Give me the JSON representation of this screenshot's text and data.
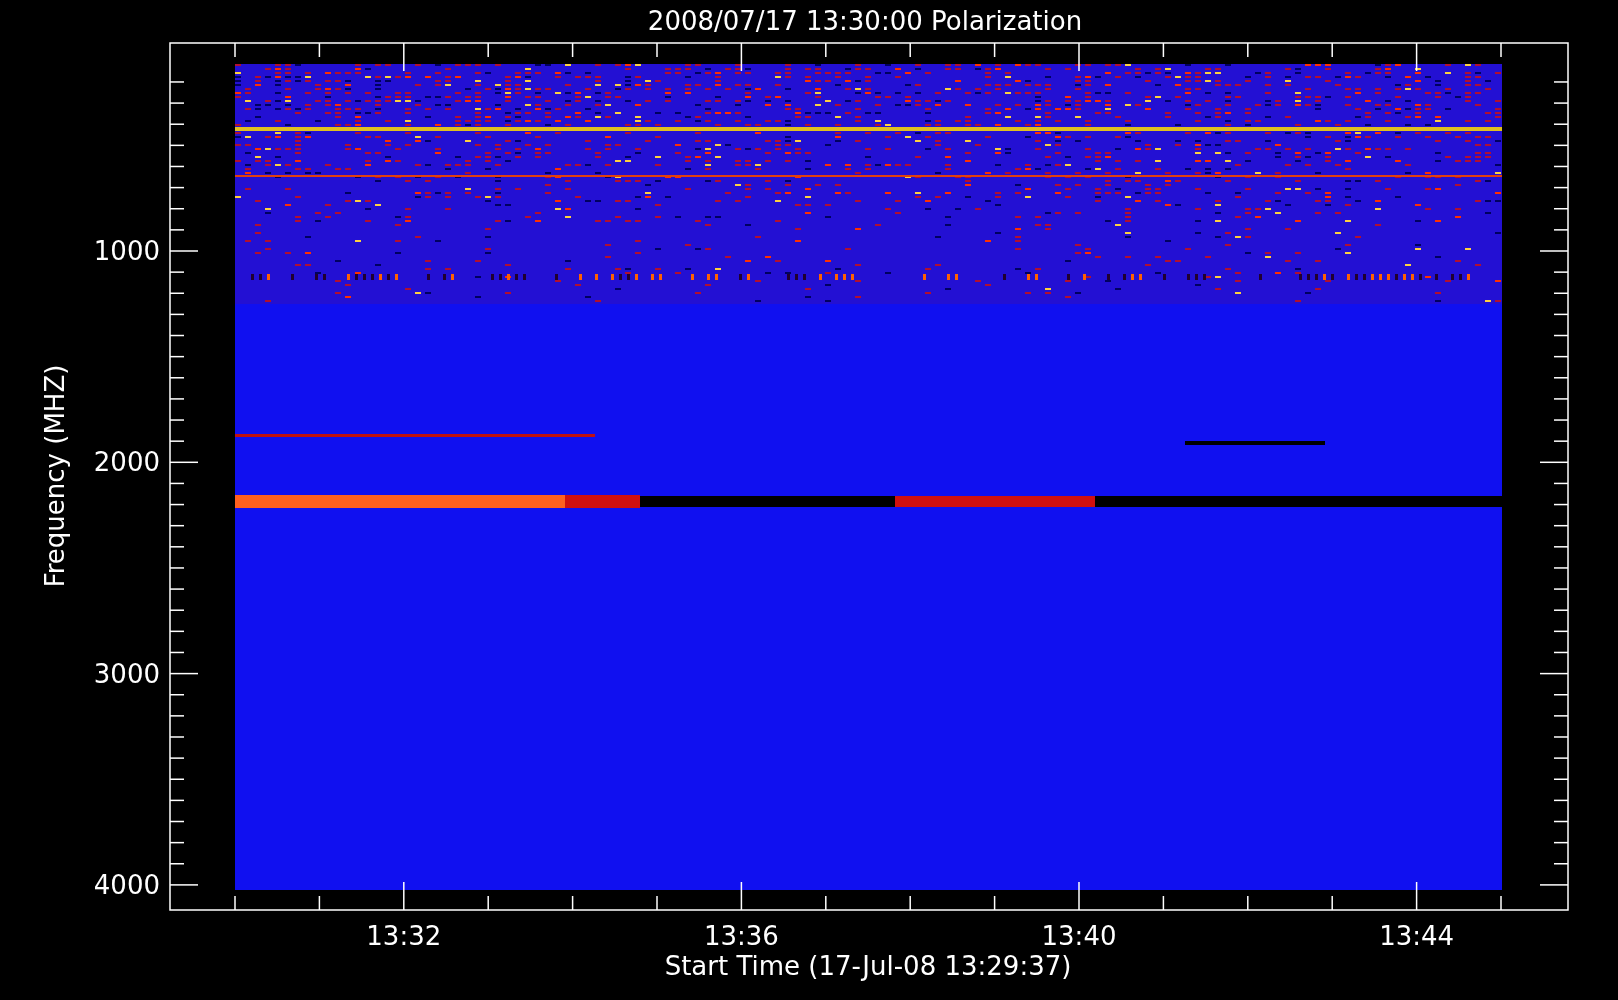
{
  "title": "2008/07/17 13:30:00 Polarization",
  "y_axis": {
    "label": "Frequency (MHZ)",
    "ticks": [
      "1000",
      "2000",
      "3000",
      "4000"
    ]
  },
  "x_axis": {
    "label": "Start Time (17-Jul-08 13:29:37)",
    "ticks": [
      "13:32",
      "13:36",
      "13:40",
      "13:44"
    ]
  }
}
